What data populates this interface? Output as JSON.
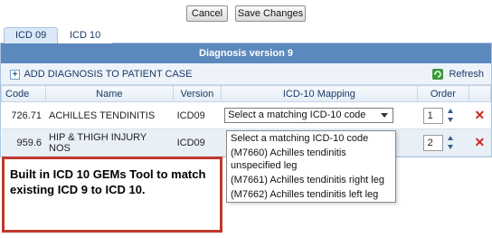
{
  "toolbar": {
    "cancel_label": "Cancel",
    "save_label": "Save Changes"
  },
  "tabs": [
    {
      "label": "ICD 09",
      "active": true
    },
    {
      "label": "ICD 10",
      "active": false
    }
  ],
  "panel": {
    "title": "Diagnosis version 9",
    "add_label": "ADD DIAGNOSIS TO PATIENT CASE",
    "refresh_label": "Refresh"
  },
  "table": {
    "headers": [
      "Code",
      "Name",
      "Version",
      "ICD-10 Mapping",
      "Order"
    ],
    "rows": [
      {
        "code": "726.71",
        "name": "ACHILLES TENDINITIS",
        "version": "ICD09",
        "mapping": "Select a matching ICD-10 code",
        "order": "1"
      },
      {
        "code": "959.6",
        "name": "HIP & THIGH INJURY NOS",
        "version": "ICD09",
        "mapping": "",
        "order": "2"
      }
    ]
  },
  "dropdown": {
    "options": [
      "Select a matching ICD-10 code",
      "(M7660) Achilles tendinitis unspecified leg",
      "(M7661) Achilles tendinitis right leg",
      "(M7662) Achilles tendinitis left leg"
    ]
  },
  "callout": {
    "text": "Built in ICD 10 GEMs Tool to match existing ICD 9 to ICD 10."
  },
  "colors": {
    "header_bar": "#5b88bd",
    "callout_border": "#c0392b",
    "delete_icon": "#c8281e"
  }
}
